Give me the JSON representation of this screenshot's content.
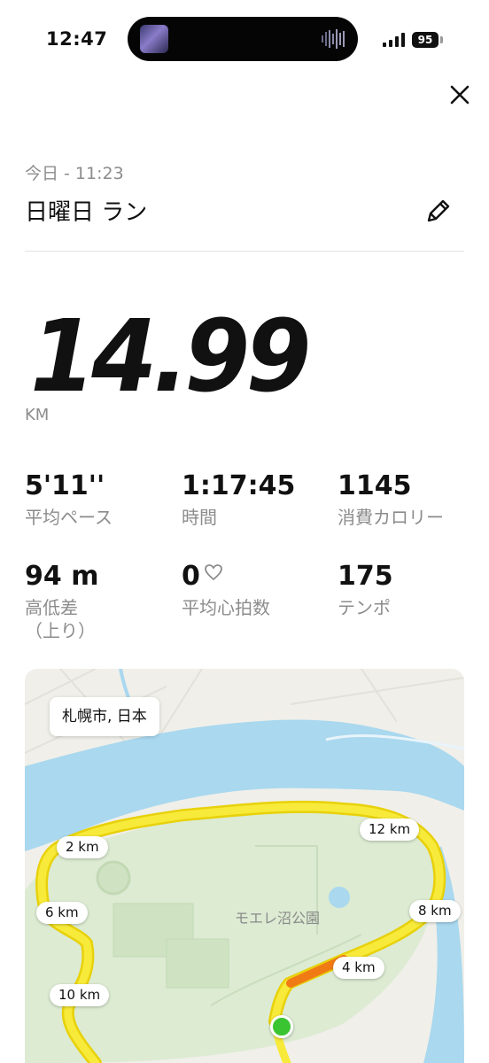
{
  "status_bar": {
    "time": "12:47",
    "battery": "95"
  },
  "header": {
    "date": "今日 - 11:23",
    "title": "日曜日 ラン"
  },
  "summary": {
    "distance": "14.99",
    "unit": "KM"
  },
  "stats": [
    {
      "value": "5'11''",
      "label": "平均ペース"
    },
    {
      "value": "1:17:45",
      "label": "時間"
    },
    {
      "value": "1145",
      "label": "消費カロリー"
    },
    {
      "value": "94 m",
      "label": "高低差\n（上り）"
    },
    {
      "value": "0",
      "label": "平均心拍数"
    },
    {
      "value": "175",
      "label": "テンポ"
    }
  ],
  "map": {
    "location": "札幌市, 日本",
    "park": "モエレ沼公園",
    "markers": [
      "2 km",
      "4 km",
      "6 km",
      "8 km",
      "10 km",
      "12 km"
    ]
  },
  "colors": {
    "route": "#f5e20c",
    "route_fast": "#f07b14",
    "start": "#3bc432",
    "water": "#a9d8ef",
    "park": "#dcebd2"
  },
  "icons": [
    "close-icon",
    "pencil-icon",
    "heart-outline-icon"
  ]
}
